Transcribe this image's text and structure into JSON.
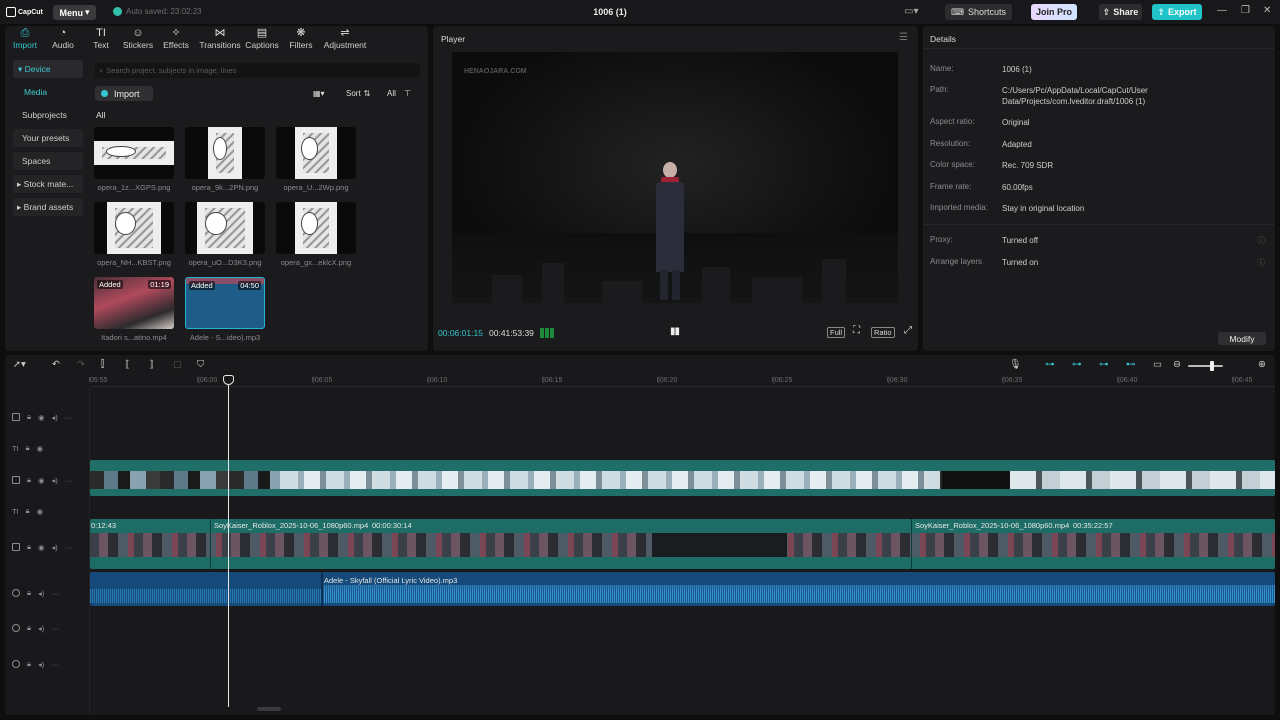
{
  "titlebar": {
    "logo": "CapCut",
    "menu": "Menu",
    "autosave": "Auto saved: 23:02:23",
    "project_title": "1006 (1)",
    "shortcuts": "Shortcuts",
    "join_pro": "Join Pro",
    "share": "Share",
    "export": "Export"
  },
  "media": {
    "tabs": [
      {
        "label": "Import",
        "icon": "import-icon",
        "active": true
      },
      {
        "label": "Audio",
        "icon": "audio-icon"
      },
      {
        "label": "Text",
        "icon": "text-icon"
      },
      {
        "label": "Stickers",
        "icon": "stickers-icon"
      },
      {
        "label": "Effects",
        "icon": "effects-icon"
      },
      {
        "label": "Transitions",
        "icon": "transitions-icon"
      },
      {
        "label": "Captions",
        "icon": "captions-icon"
      },
      {
        "label": "Filters",
        "icon": "filters-icon"
      },
      {
        "label": "Adjustment",
        "icon": "adjustment-icon"
      }
    ],
    "side": {
      "device": "Device",
      "media": "Media",
      "subprojects": "Subprojects",
      "presets": "Your presets",
      "spaces": "Spaces",
      "stock": "Stock mate...",
      "brand": "Brand assets"
    },
    "search_placeholder": "Search project, subjects in image, lines",
    "import_label": "Import",
    "sort_label": "Sort",
    "filter_label": "All",
    "all_label": "All",
    "items": [
      {
        "name": "opera_1z...XGPS.png",
        "kind": "image"
      },
      {
        "name": "opera_9k...2PN.png",
        "kind": "image"
      },
      {
        "name": "opera_U...2Wp.png",
        "kind": "image"
      },
      {
        "name": "opera_NH...KBST.png",
        "kind": "image"
      },
      {
        "name": "opera_uO...D3K3.png",
        "kind": "image"
      },
      {
        "name": "opera_gx...eklcX.png",
        "kind": "image"
      },
      {
        "name": "Itadori s...atino.mp4",
        "kind": "video",
        "added": "Added",
        "duration": "01:19"
      },
      {
        "name": "Adele - S...ideo).mp3",
        "kind": "audio",
        "added": "Added",
        "duration": "04:50"
      }
    ]
  },
  "player": {
    "label": "Player",
    "watermark": "HENAOJARA.COM",
    "current_time": "00:06:01:15",
    "total_time": "00:41:53:39",
    "full": "Full",
    "ratio": "Ratio"
  },
  "details": {
    "title": "Details",
    "rows": [
      {
        "k": "Name:",
        "v": "1006 (1)"
      },
      {
        "k": "Path:",
        "v": "C:/Users/Pc/AppData/Local/CapCut/User Data/Projects/com.lveditor.draft/1006 (1)"
      },
      {
        "k": "Aspect ratio:",
        "v": "Original"
      },
      {
        "k": "Resolution:",
        "v": "Adapted"
      },
      {
        "k": "Color space:",
        "v": "Rec. 709 SDR"
      },
      {
        "k": "Frame rate:",
        "v": "60.00fps"
      },
      {
        "k": "Imported media:",
        "v": "Stay in original location"
      },
      {
        "k": "Proxy:",
        "v": "Turned off"
      },
      {
        "k": "Arrange layers",
        "v": "Turned on"
      }
    ],
    "modify": "Modify"
  },
  "timeline": {
    "ticks": [
      "05:55",
      "|06:00",
      "|06:05",
      "|06:10",
      "|06:15",
      "|06:20",
      "|06:25",
      "|06:30",
      "|06:35",
      "|06:40",
      "|06:45"
    ],
    "clip1_time": "0:12:43",
    "clip2_label": "SoyKaiser_Roblox_2025-10-06_1080p60.mp4",
    "clip2_time": "00:00:30:14",
    "clip3_label": "SoyKaiser_Roblox_2025-10-06_1080p60.mp4",
    "clip3_time": "00:35:22:57",
    "audio_label": "Adele - Skyfall (Official Lyric Video).mp3"
  }
}
